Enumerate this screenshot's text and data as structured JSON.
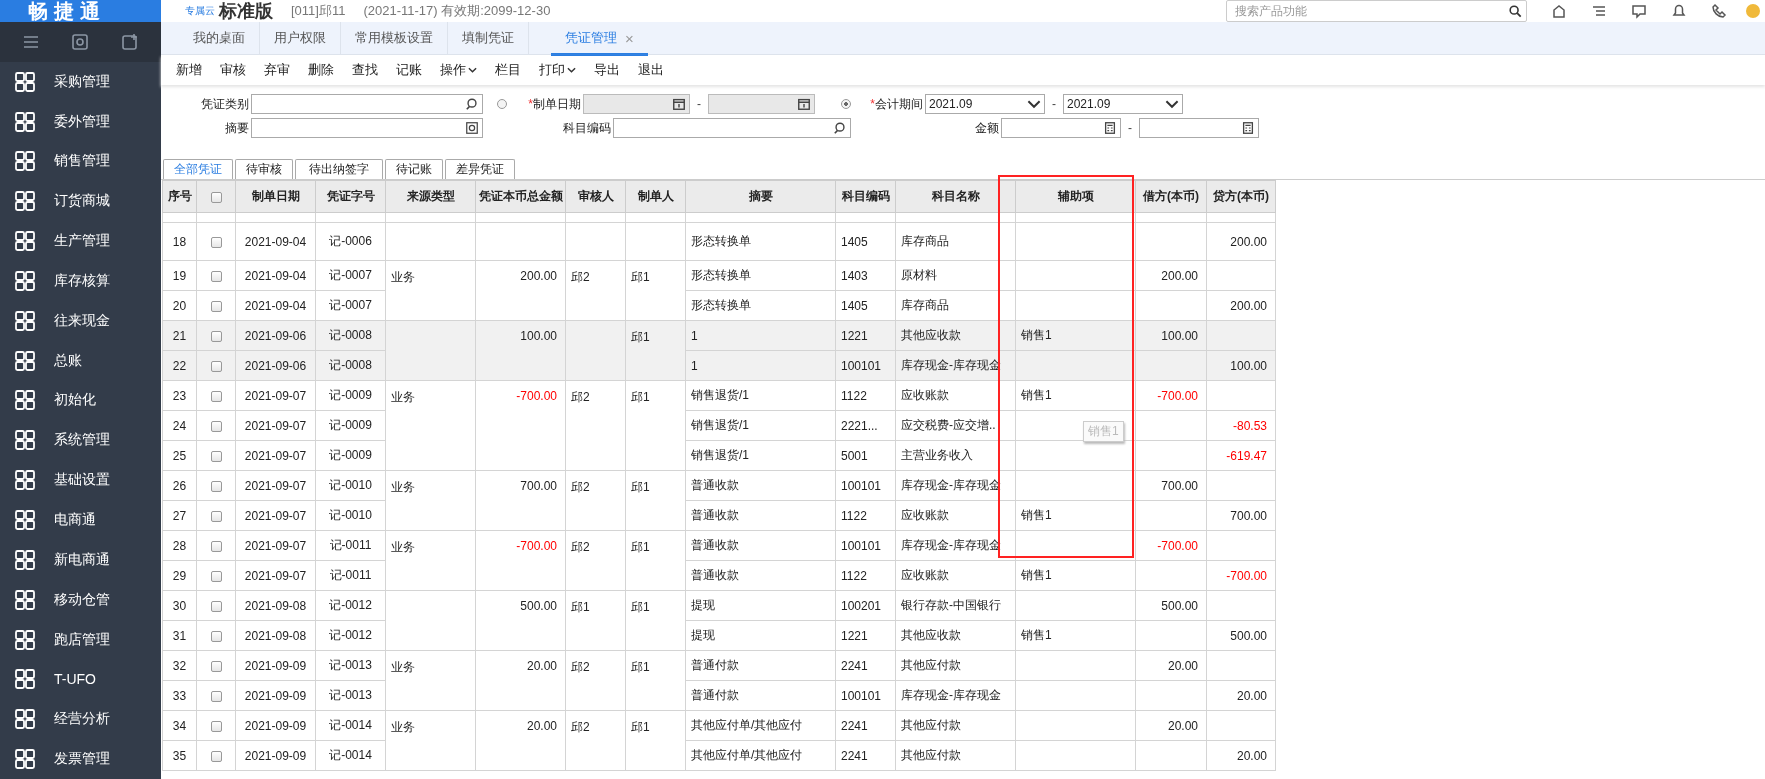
{
  "sidebar": {
    "logo": "畅捷通",
    "items": [
      {
        "label": "采购管理"
      },
      {
        "label": "委外管理"
      },
      {
        "label": "销售管理"
      },
      {
        "label": "订货商城"
      },
      {
        "label": "生产管理"
      },
      {
        "label": "库存核算"
      },
      {
        "label": "往来现金"
      },
      {
        "label": "总账"
      },
      {
        "label": "初始化"
      },
      {
        "label": "系统管理"
      },
      {
        "label": "基础设置"
      },
      {
        "label": "电商通"
      },
      {
        "label": "新电商通"
      },
      {
        "label": "移动仓管"
      },
      {
        "label": "跑店管理"
      },
      {
        "label": "T-UFO"
      },
      {
        "label": "经营分析"
      },
      {
        "label": "发票管理"
      }
    ]
  },
  "header": {
    "cloud": "专属云",
    "edition": "标准版",
    "account": "[011]邱11",
    "validity": "(2021-11-17)  有效期:2099-12-30",
    "search": {
      "placeholder": "搜索产品功能"
    }
  },
  "tabs": [
    {
      "label": "我的桌面",
      "selected": false
    },
    {
      "label": "用户权限",
      "selected": false
    },
    {
      "label": "常用模板设置",
      "selected": false
    },
    {
      "label": "填制凭证",
      "selected": false
    },
    {
      "label": "凭证管理",
      "selected": true,
      "close": "×"
    }
  ],
  "toolbar": [
    {
      "label": "新增",
      "kind": "button"
    },
    {
      "label": "审核",
      "kind": "button"
    },
    {
      "label": "弃审",
      "kind": "button"
    },
    {
      "label": "删除",
      "kind": "button"
    },
    {
      "label": "查找",
      "kind": "button"
    },
    {
      "label": "记账",
      "kind": "button"
    },
    {
      "label": "操作",
      "kind": "dropdown"
    },
    {
      "label": "栏目",
      "kind": "button"
    },
    {
      "label": "打印",
      "kind": "dropdown"
    },
    {
      "label": "导出",
      "kind": "button"
    },
    {
      "label": "退出",
      "kind": "button"
    }
  ],
  "filters": {
    "voucher_type": {
      "label": "凭证类别"
    },
    "summary": {
      "label": "摘要"
    },
    "date": {
      "mark": "*",
      "label": "制单日期",
      "selected": false,
      "separator": "-"
    },
    "account_code": {
      "label": "科目编码"
    },
    "period": {
      "mark": "*",
      "label": "会计期间",
      "selected": true,
      "from": "2021.09",
      "to": "2021.09",
      "separator": "-"
    },
    "amount": {
      "label": "金额",
      "separator": "-"
    }
  },
  "status_tabs": [
    {
      "label": "全部凭证",
      "selected": true
    },
    {
      "label": "待审核",
      "selected": false
    },
    {
      "label": "待出纳签字",
      "selected": false
    },
    {
      "label": "待记账",
      "selected": false
    },
    {
      "label": "差异凭证",
      "selected": false
    }
  ],
  "table": {
    "columns": [
      "序号",
      "",
      "制单日期",
      "凭证字号",
      "来源类型",
      "凭证本币总金额",
      "审核人",
      "制单人",
      "摘要",
      "科目编码",
      "科目名称",
      "辅助项",
      "借方(本币)",
      "贷方(本币)"
    ],
    "header_checked": false,
    "vouchers": [
      {
        "selected": false,
        "lines": [
          {
            "no": "18",
            "checked": false,
            "date": "2021-09-04",
            "code": "记-0006",
            "summary": "形态转换单",
            "account_code": "1405",
            "account_name": "库存商品",
            "credit": "200.00",
            "negative": false
          }
        ]
      },
      {
        "selected": false,
        "source": "业务",
        "total": "200.00",
        "total_negative": false,
        "reviewer": "邱2",
        "preparer": "邱1",
        "lines": [
          {
            "no": "19",
            "checked": false,
            "date": "2021-09-04",
            "code": "记-0007",
            "summary": "形态转换单",
            "account_code": "1403",
            "account_name": "原材料",
            "debit": "200.00",
            "negative": false
          },
          {
            "no": "20",
            "checked": false,
            "date": "2021-09-04",
            "code": "记-0007",
            "summary": "形态转换单",
            "account_code": "1405",
            "account_name": "库存商品",
            "credit": "200.00",
            "negative": false
          }
        ]
      },
      {
        "selected": true,
        "total": "100.00",
        "total_negative": false,
        "preparer": "邱1",
        "lines": [
          {
            "no": "21",
            "checked": false,
            "date": "2021-09-06",
            "code": "记-0008",
            "summary": "1",
            "account_code": "1221",
            "account_name": "其他应收款",
            "aux": "销售1",
            "debit": "100.00",
            "negative": false
          },
          {
            "no": "22",
            "checked": false,
            "date": "2021-09-06",
            "code": "记-0008",
            "summary": "1",
            "account_code": "100101",
            "account_name": "库存现金-库存现金",
            "credit": "100.00",
            "negative": false
          }
        ]
      },
      {
        "selected": false,
        "source": "业务",
        "total": "-700.00",
        "total_negative": true,
        "reviewer": "邱2",
        "preparer": "邱1",
        "lines": [
          {
            "no": "23",
            "checked": false,
            "date": "2021-09-07",
            "code": "记-0009",
            "summary": "销售退货/1",
            "account_code": "1122",
            "account_name": "应收账款",
            "aux": "销售1",
            "debit": "-700.00",
            "negative": true
          },
          {
            "no": "24",
            "checked": false,
            "date": "2021-09-07",
            "code": "记-0009",
            "summary": "销售退货/1",
            "account_code": "2221...",
            "account_name": "应交税费-应交增..",
            "credit": "-80.53",
            "negative": true
          },
          {
            "no": "25",
            "checked": false,
            "date": "2021-09-07",
            "code": "记-0009",
            "summary": "销售退货/1",
            "account_code": "5001",
            "account_name": "主营业务收入",
            "credit": "-619.47",
            "negative": true
          }
        ]
      },
      {
        "selected": false,
        "source": "业务",
        "total": "700.00",
        "total_negative": false,
        "reviewer": "邱2",
        "preparer": "邱1",
        "lines": [
          {
            "no": "26",
            "checked": false,
            "date": "2021-09-07",
            "code": "记-0010",
            "summary": "普通收款",
            "account_code": "100101",
            "account_name": "库存现金-库存现金",
            "debit": "700.00",
            "negative": false
          },
          {
            "no": "27",
            "checked": false,
            "date": "2021-09-07",
            "code": "记-0010",
            "summary": "普通收款",
            "account_code": "1122",
            "account_name": "应收账款",
            "aux": "销售1",
            "credit": "700.00",
            "negative": false
          }
        ]
      },
      {
        "selected": false,
        "source": "业务",
        "total": "-700.00",
        "total_negative": true,
        "reviewer": "邱2",
        "preparer": "邱1",
        "lines": [
          {
            "no": "28",
            "checked": false,
            "date": "2021-09-07",
            "code": "记-0011",
            "summary": "普通收款",
            "account_code": "100101",
            "account_name": "库存现金-库存现金",
            "debit": "-700.00",
            "negative": true
          },
          {
            "no": "29",
            "checked": false,
            "date": "2021-09-07",
            "code": "记-0011",
            "summary": "普通收款",
            "account_code": "1122",
            "account_name": "应收账款",
            "aux": "销售1",
            "credit": "-700.00",
            "negative": true
          }
        ]
      },
      {
        "selected": false,
        "total": "500.00",
        "total_negative": false,
        "reviewer": "邱1",
        "preparer": "邱1",
        "lines": [
          {
            "no": "30",
            "checked": false,
            "date": "2021-09-08",
            "code": "记-0012",
            "summary": "提现",
            "account_code": "100201",
            "account_name": "银行存款-中国银行",
            "debit": "500.00",
            "negative": false
          },
          {
            "no": "31",
            "checked": false,
            "date": "2021-09-08",
            "code": "记-0012",
            "summary": "提现",
            "account_code": "1221",
            "account_name": "其他应收款",
            "aux": "销售1",
            "credit": "500.00",
            "negative": false
          }
        ]
      },
      {
        "selected": false,
        "source": "业务",
        "total": "20.00",
        "total_negative": false,
        "reviewer": "邱2",
        "preparer": "邱1",
        "lines": [
          {
            "no": "32",
            "checked": false,
            "date": "2021-09-09",
            "code": "记-0013",
            "summary": "普通付款",
            "account_code": "2241",
            "account_name": "其他应付款",
            "debit": "20.00",
            "negative": false
          },
          {
            "no": "33",
            "checked": false,
            "date": "2021-09-09",
            "code": "记-0013",
            "summary": "普通付款",
            "account_code": "100101",
            "account_name": "库存现金-库存现金",
            "credit": "20.00",
            "negative": false
          }
        ]
      },
      {
        "selected": false,
        "source": "业务",
        "total": "20.00",
        "total_negative": false,
        "reviewer": "邱2",
        "preparer": "邱1",
        "lines": [
          {
            "no": "34",
            "checked": false,
            "date": "2021-09-09",
            "code": "记-0014",
            "summary": "其他应付单/其他应付",
            "account_code": "2241",
            "account_name": "其他应付款",
            "debit": "20.00",
            "negative": false
          },
          {
            "no": "35",
            "checked": false,
            "date": "2021-09-09",
            "code": "记-0014",
            "summary": "其他应付单/其他应付",
            "account_code": "2241",
            "account_name": "其他应付款",
            "credit": "20.00",
            "negative": false
          }
        ]
      }
    ]
  },
  "tooltip": {
    "text": "销售1"
  }
}
